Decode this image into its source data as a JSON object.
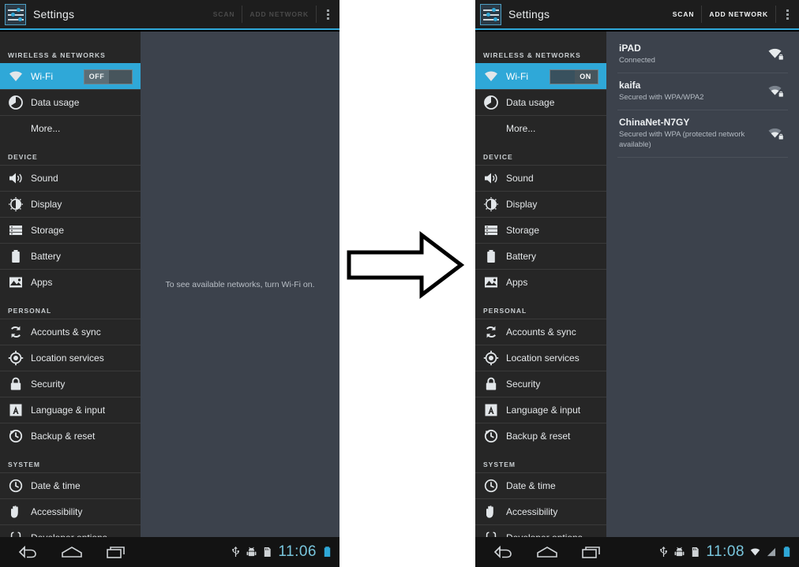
{
  "theme": {
    "accent": "#2fa8d8",
    "sidebar_bg": "#262626",
    "content_bg": "#3c424c",
    "actionbar_bg": "#1d1d1d",
    "navbar_bg": "#131313",
    "clock_color": "#79c6dd"
  },
  "app": {
    "title": "Settings",
    "icon": "settings-sliders-icon"
  },
  "actionbar": {
    "scan_label": "SCAN",
    "add_network_label": "ADD NETWORK",
    "overflow_icon": "overflow-menu-icon"
  },
  "sidebar": {
    "sections": [
      {
        "header": "WIRELESS & NETWORKS",
        "items": [
          {
            "label": "Wi-Fi",
            "icon": "wifi-icon",
            "selected": true,
            "has_toggle": true
          },
          {
            "label": "Data usage",
            "icon": "data-usage-icon",
            "selected": false
          },
          {
            "label": "More...",
            "icon": "none",
            "selected": false,
            "indent": true
          }
        ]
      },
      {
        "header": "DEVICE",
        "items": [
          {
            "label": "Sound",
            "icon": "sound-icon"
          },
          {
            "label": "Display",
            "icon": "display-icon"
          },
          {
            "label": "Storage",
            "icon": "storage-icon"
          },
          {
            "label": "Battery",
            "icon": "battery-icon"
          },
          {
            "label": "Apps",
            "icon": "apps-icon"
          }
        ]
      },
      {
        "header": "PERSONAL",
        "items": [
          {
            "label": "Accounts & sync",
            "icon": "sync-icon"
          },
          {
            "label": "Location services",
            "icon": "location-icon"
          },
          {
            "label": "Security",
            "icon": "lock-icon"
          },
          {
            "label": "Language & input",
            "icon": "language-icon"
          },
          {
            "label": "Backup & reset",
            "icon": "backup-reset-icon"
          }
        ]
      },
      {
        "header": "SYSTEM",
        "items": [
          {
            "label": "Date & time",
            "icon": "clock-icon"
          },
          {
            "label": "Accessibility",
            "icon": "accessibility-hand-icon"
          },
          {
            "label": "Developer options",
            "icon": "braces-icon"
          }
        ]
      }
    ]
  },
  "left_panel": {
    "wifi_state": "OFF",
    "toggle_label": "OFF",
    "scan_enabled": false,
    "add_network_enabled": false,
    "empty_message": "To see available networks, turn Wi-Fi on.",
    "navbar": {
      "time": "11:06",
      "tray_icons": [
        "usb-icon",
        "android-debug-icon",
        "sd-card-icon",
        "battery-icon"
      ]
    }
  },
  "right_panel": {
    "wifi_state": "ON",
    "toggle_label": "ON",
    "scan_enabled": true,
    "add_network_enabled": true,
    "networks": [
      {
        "ssid": "iPAD",
        "status": "Connected",
        "signal": 3,
        "secured": true
      },
      {
        "ssid": "kaifa",
        "status": "Secured with WPA/WPA2",
        "signal": 2,
        "secured": true
      },
      {
        "ssid": "ChinaNet-N7GY",
        "status": "Secured with WPA (protected network available)",
        "signal": 2,
        "secured": true
      }
    ],
    "navbar": {
      "time": "11:08",
      "tray_icons": [
        "usb-icon",
        "android-debug-icon",
        "sd-card-icon",
        "wifi-icon",
        "signal-icon",
        "battery-icon"
      ]
    }
  },
  "nav_buttons": {
    "back": "back-icon",
    "home": "home-icon",
    "recents": "recents-icon"
  },
  "transition": {
    "arrow": "right-arrow"
  }
}
